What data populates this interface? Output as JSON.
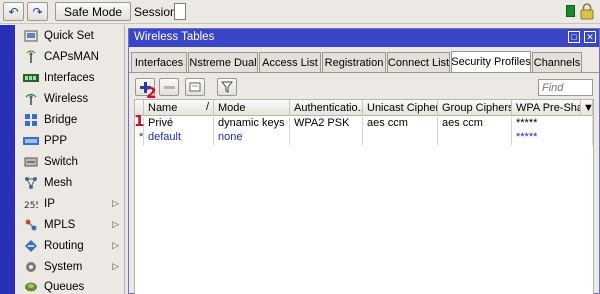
{
  "toolbar": {
    "undo_icon": "undo-icon",
    "redo_icon": "redo-icon",
    "safe_mode_label": "Safe Mode",
    "session_label": "Session:"
  },
  "sidebar": {
    "items": [
      {
        "label": "Quick Set",
        "icon": "quick-set-icon",
        "arrow": false
      },
      {
        "label": "CAPsMAN",
        "icon": "capsman-icon",
        "arrow": false
      },
      {
        "label": "Interfaces",
        "icon": "interfaces-icon",
        "arrow": false
      },
      {
        "label": "Wireless",
        "icon": "wireless-icon",
        "arrow": false
      },
      {
        "label": "Bridge",
        "icon": "bridge-icon",
        "arrow": false
      },
      {
        "label": "PPP",
        "icon": "ppp-icon",
        "arrow": false
      },
      {
        "label": "Switch",
        "icon": "switch-icon",
        "arrow": false
      },
      {
        "label": "Mesh",
        "icon": "mesh-icon",
        "arrow": false
      },
      {
        "label": "IP",
        "icon": "ip-icon",
        "arrow": true
      },
      {
        "label": "MPLS",
        "icon": "mpls-icon",
        "arrow": true
      },
      {
        "label": "Routing",
        "icon": "routing-icon",
        "arrow": true
      },
      {
        "label": "System",
        "icon": "system-icon",
        "arrow": true
      },
      {
        "label": "Queues",
        "icon": "queues-icon",
        "arrow": false
      }
    ]
  },
  "window": {
    "title": "Wireless Tables",
    "tabs": [
      {
        "label": "Interfaces",
        "active": false
      },
      {
        "label": "Nstreme Dual",
        "active": false
      },
      {
        "label": "Access List",
        "active": false
      },
      {
        "label": "Registration",
        "active": false
      },
      {
        "label": "Connect List",
        "active": false
      },
      {
        "label": "Security Profiles",
        "active": true
      },
      {
        "label": "Channels",
        "active": false
      }
    ],
    "find_placeholder": "Find",
    "columns": [
      "Name",
      "Mode",
      "Authenticatio...",
      "Unicast Ciphers",
      "Group Ciphers",
      "WPA Pre-Shar"
    ],
    "rows": [
      {
        "flag": "",
        "name": "Privé",
        "mode": "dynamic keys",
        "auth": "WPA2 PSK",
        "unicast": "aes ccm",
        "group": "aes ccm",
        "psk": "*****"
      },
      {
        "flag": "*",
        "name": "default",
        "mode": "none",
        "auth": "",
        "unicast": "",
        "group": "",
        "psk": "*****"
      }
    ],
    "annotations": {
      "one": "1",
      "two": "2"
    }
  },
  "colors": {
    "accent_blue": "#2730b6",
    "title_bar": "#3a45c8",
    "status_green": "#1c8a2b",
    "annotation_red": "#c8102e"
  }
}
